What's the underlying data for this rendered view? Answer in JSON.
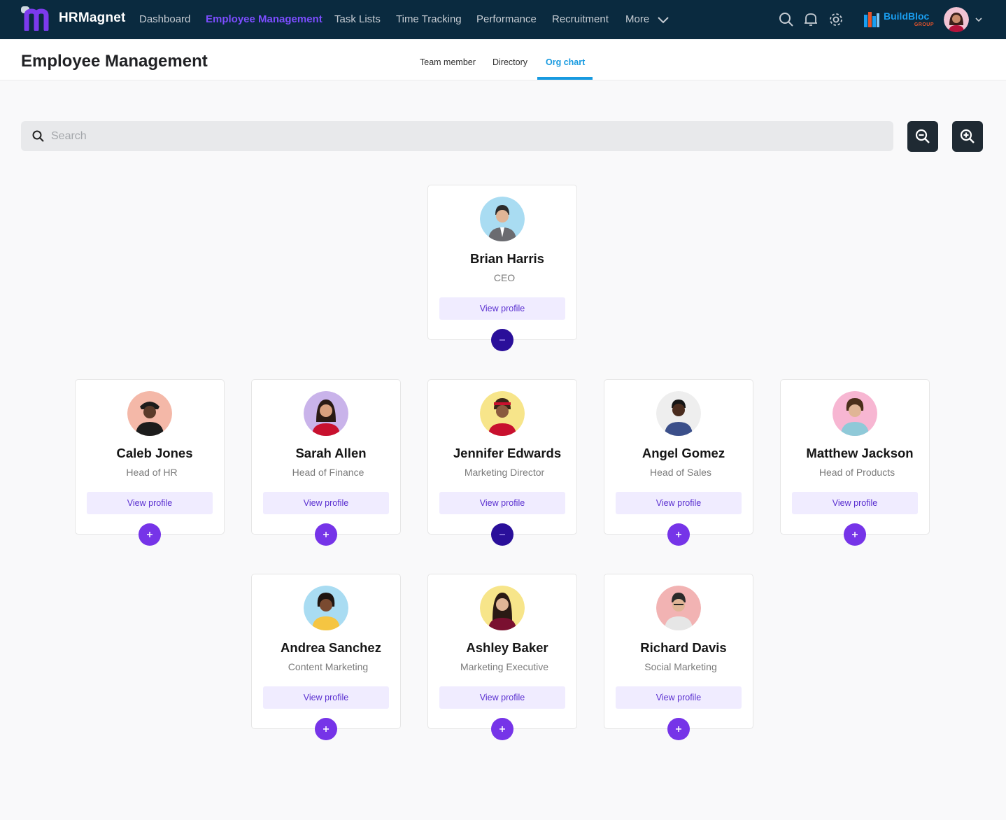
{
  "app": {
    "name": "HRMagnet"
  },
  "nav": {
    "items": [
      {
        "label": "Dashboard",
        "active": false
      },
      {
        "label": "Employee Management",
        "active": true
      },
      {
        "label": "Task Lists",
        "active": false
      },
      {
        "label": "Time Tracking",
        "active": false
      },
      {
        "label": "Performance",
        "active": false
      },
      {
        "label": "Recruitment",
        "active": false
      },
      {
        "label": "More",
        "active": false
      }
    ],
    "icons": [
      "search-icon",
      "bell-icon",
      "gear-icon"
    ]
  },
  "brand": {
    "name": "BuildBloc",
    "sub": "GROUP"
  },
  "page": {
    "title": "Employee Management",
    "tabs": [
      {
        "label": "Team member",
        "active": false
      },
      {
        "label": "Directory",
        "active": false
      },
      {
        "label": "Org chart",
        "active": true
      }
    ]
  },
  "search": {
    "placeholder": "Search",
    "value": ""
  },
  "org": {
    "view_label": "View profile",
    "ceo": {
      "name": "Brian Harris",
      "role": "CEO",
      "expanded": true
    },
    "level1": [
      {
        "name": "Caleb Jones",
        "role": "Head of HR",
        "expanded": false
      },
      {
        "name": "Sarah Allen",
        "role": "Head of Finance",
        "expanded": false
      },
      {
        "name": "Jennifer Edwards",
        "role": "Marketing Director",
        "expanded": true
      },
      {
        "name": "Angel Gomez",
        "role": "Head of Sales",
        "expanded": false
      },
      {
        "name": "Matthew Jackson",
        "role": "Head of Products",
        "expanded": false
      }
    ],
    "level2": [
      {
        "name": "Andrea Sanchez",
        "role": "Content Marketing",
        "expanded": false
      },
      {
        "name": "Ashley Baker",
        "role": "Marketing Executive",
        "expanded": false
      },
      {
        "name": "Richard Davis",
        "role": "Social Marketing",
        "expanded": false
      }
    ]
  },
  "colors": {
    "nav_bg": "#0a2a3f",
    "accent_purple": "#7634e8",
    "accent_blue": "#179ae0",
    "collapse_purple": "#2a0f9a"
  }
}
